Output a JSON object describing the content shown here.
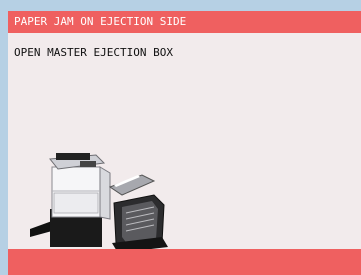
{
  "panel": {
    "title": "PAPER JAM ON EJECTION SIDE",
    "message": "OPEN MASTER EJECTION BOX"
  },
  "illustration": {
    "subject": "duplicator-with-open-ejection-box",
    "icon": "printer-illustration"
  },
  "colors": {
    "alert": "#ef6060",
    "panel_background": "#f2ebec"
  }
}
